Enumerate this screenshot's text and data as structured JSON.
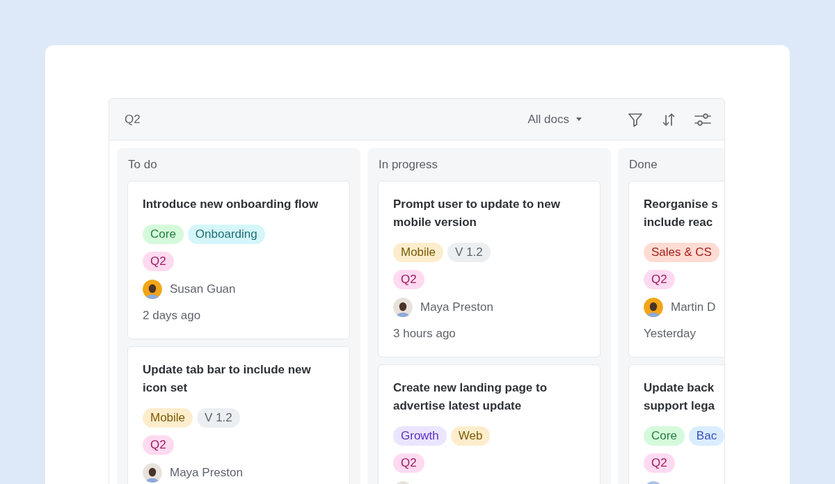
{
  "board": {
    "title": "Q2",
    "view_menu": {
      "label": "All docs"
    },
    "columns": [
      {
        "title": "To do",
        "cards": [
          {
            "title": "Introduce new onboarding flow",
            "tags": [
              {
                "label": "Core",
                "color": "#237a3f"
              },
              {
                "label": "Onboarding",
                "color": "#1f6f78"
              }
            ],
            "milestone": {
              "label": "Q2",
              "color": "#9c1b5e"
            },
            "assignee": {
              "name": "Susan Guan",
              "color": "#f2a516"
            },
            "updated": "2 days ago"
          },
          {
            "title": "Update tab bar to include new\nicon set",
            "tags": [
              {
                "label": "Mobile",
                "color": "#7a5a00"
              },
              {
                "label": "V 1.2",
                "color": "#5f636a"
              }
            ],
            "milestone": {
              "label": "Q2",
              "color": "#9c1b5e"
            },
            "assignee": {
              "name": "Maya Preston",
              "color": "#e8e2dc"
            }
          }
        ]
      },
      {
        "title": "In progress",
        "cards": [
          {
            "title": "Prompt user to update to new\nmobile version",
            "tags": [
              {
                "label": "Mobile",
                "color": "#7a5a00"
              },
              {
                "label": "V 1.2",
                "color": "#5f636a"
              }
            ],
            "milestone": {
              "label": "Q2",
              "color": "#9c1b5e"
            },
            "assignee": {
              "name": "Maya Preston",
              "color": "#e8e2dc"
            },
            "updated": "3 hours ago"
          },
          {
            "title": "Create new landing page to\nadvertise latest update",
            "tags": [
              {
                "label": "Growth",
                "color": "#5a2fc2"
              },
              {
                "label": "Web",
                "color": "#7a5a00"
              }
            ],
            "milestone": {
              "label": "Q2",
              "color": "#9c1b5e"
            },
            "assignee": {
              "color": "#e8e2dc"
            }
          }
        ]
      },
      {
        "title": "Done",
        "cards": [
          {
            "title": "Reorganise s\ninclude reac",
            "tags": [
              {
                "label": "Sales & CS",
                "color": "#a31d1d"
              }
            ],
            "milestone": {
              "label": "Q2",
              "color": "#9c1b5e"
            },
            "assignee": {
              "name": "Martin D",
              "color": "#f2a516"
            },
            "updated": "Yesterday"
          },
          {
            "title": "Update back\nsupport lega",
            "tags": [
              {
                "label": "Core",
                "color": "#237a3f"
              },
              {
                "label": "Bac",
                "color": "#3a4fc0"
              }
            ],
            "milestone": {
              "label": "Q2",
              "color": "#9c1b5e"
            },
            "assignee": {
              "color": "#a9c0ea"
            }
          }
        ]
      }
    ]
  }
}
